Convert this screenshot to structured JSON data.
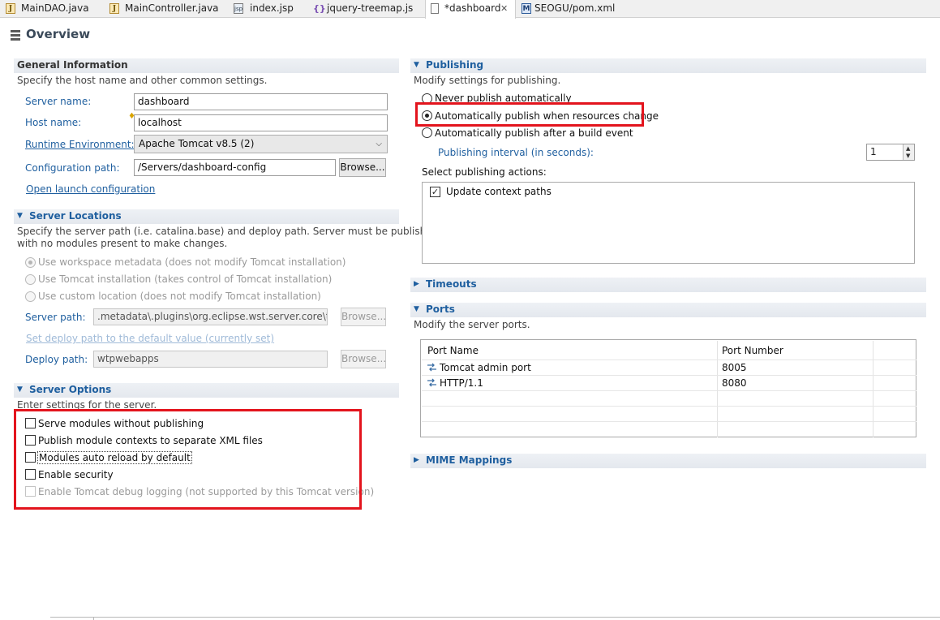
{
  "tabs": [
    {
      "label": "MainDAO.java",
      "icon": "java-file-icon"
    },
    {
      "label": "MainController.java",
      "icon": "java-file-icon"
    },
    {
      "label": "index.jsp",
      "icon": "jsp-file-icon"
    },
    {
      "label": "jquery-treemap.js",
      "icon": "js-file-icon"
    },
    {
      "label": "*dashboard",
      "icon": "server-icon",
      "active": true
    },
    {
      "label": "SEOGU/pom.xml",
      "icon": "maven-pom-icon"
    }
  ],
  "overview": {
    "title": "Overview"
  },
  "general": {
    "title": "General Information",
    "desc": "Specify the host name and other common settings.",
    "server_name_label": "Server name:",
    "server_name_value": "dashboard",
    "host_name_label": "Host name:",
    "host_name_value": "localhost",
    "runtime_label": "Runtime Environment:",
    "runtime_value": "Apache Tomcat v8.5 (2)",
    "config_label": "Configuration path:",
    "config_value": "/Servers/dashboard-config",
    "browse_label": "Browse...",
    "open_launch_link": "Open launch configuration"
  },
  "locations": {
    "title": "Server Locations",
    "desc1": "Specify the server path (i.e. catalina.base) and deploy path. Server must be published",
    "desc2": "with no modules present to make changes.",
    "opt_workspace": "Use workspace metadata (does not modify Tomcat installation)",
    "opt_tomcat": "Use Tomcat installation (takes control of Tomcat installation)",
    "opt_custom": "Use custom location (does not modify Tomcat installation)",
    "server_path_label": "Server path:",
    "server_path_value": ".metadata\\.plugins\\org.eclipse.wst.server.core\\tmp",
    "browse_label": "Browse...",
    "set_default_link": "Set deploy path to the default value (currently set)",
    "deploy_path_label": "Deploy path:",
    "deploy_path_value": "wtpwebapps"
  },
  "options": {
    "title": "Server Options",
    "desc": "Enter settings for the server.",
    "serve_modules": "Serve modules without publishing",
    "publish_contexts": "Publish module contexts to separate XML files",
    "auto_reload": "Modules auto reload by default",
    "enable_security": "Enable security",
    "debug_logging": "Enable Tomcat debug logging (not supported by this Tomcat version)"
  },
  "publishing": {
    "title": "Publishing",
    "desc": "Modify settings for publishing.",
    "never": "Never publish automatically",
    "auto_resources": "Automatically publish when resources change",
    "auto_build": "Automatically publish after a build event",
    "interval_label": "Publishing interval (in seconds):",
    "interval_value": "1",
    "actions_label": "Select publishing actions:",
    "update_context": "Update context paths"
  },
  "timeouts": {
    "title": "Timeouts"
  },
  "ports": {
    "title": "Ports",
    "desc": "Modify the server ports.",
    "col_name": "Port Name",
    "col_number": "Port Number",
    "rows": [
      {
        "name": "Tomcat admin port",
        "number": "8005"
      },
      {
        "name": "HTTP/1.1",
        "number": "8080"
      }
    ]
  },
  "mime": {
    "title": "MIME Mappings"
  },
  "colors": {
    "highlight": "#e3141d",
    "section_blue": "#1f5f9f"
  }
}
